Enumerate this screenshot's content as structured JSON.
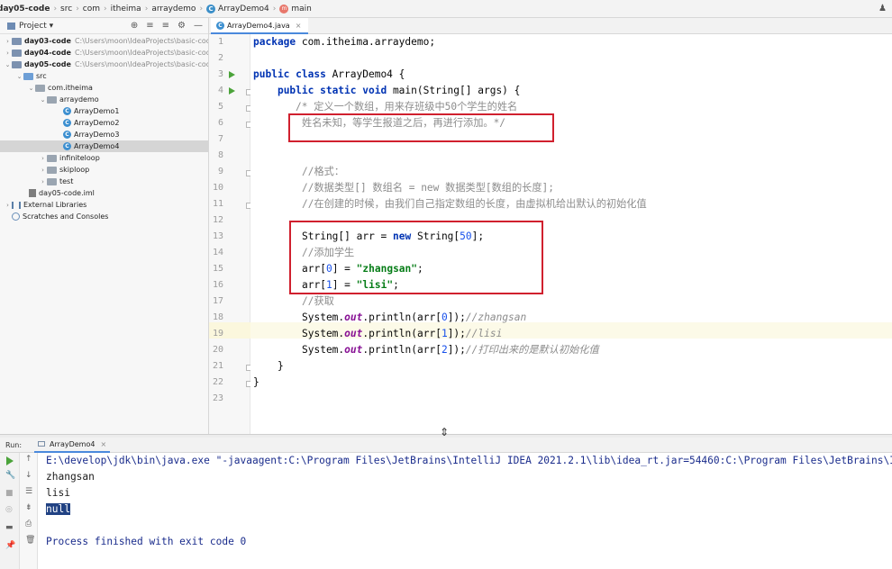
{
  "breadcrumb": [
    "day05-code",
    "src",
    "com",
    "itheima",
    "arraydemo",
    "ArrayDemo4",
    "main"
  ],
  "project_panel": {
    "title": "Project",
    "tree": [
      {
        "label": "day03-code",
        "path": "C:\\Users\\moon\\IdeaProjects\\basic-code"
      },
      {
        "label": "day04-code",
        "path": "C:\\Users\\moon\\IdeaProjects\\basic-code"
      },
      {
        "label": "day05-code",
        "path": "C:\\Users\\moon\\IdeaProjects\\basic-code"
      },
      {
        "label": "src"
      },
      {
        "label": "com.itheima"
      },
      {
        "label": "arraydemo"
      },
      {
        "label": "ArrayDemo1"
      },
      {
        "label": "ArrayDemo2"
      },
      {
        "label": "ArrayDemo3"
      },
      {
        "label": "ArrayDemo4"
      },
      {
        "label": "infiniteloop"
      },
      {
        "label": "skiploop"
      },
      {
        "label": "test"
      },
      {
        "label": "day05-code.iml"
      },
      {
        "label": "External Libraries"
      },
      {
        "label": "Scratches and Consoles"
      }
    ]
  },
  "editor": {
    "tab": "ArrayDemo4.java",
    "line_numbers": [
      "1",
      "2",
      "3",
      "4",
      "5",
      "6",
      "7",
      "8",
      "9",
      "10",
      "11",
      "12",
      "13",
      "14",
      "15",
      "16",
      "17",
      "18",
      "19",
      "20",
      "21",
      "22",
      "23"
    ],
    "lines": {
      "l1": "package com.itheima.arraydemo;",
      "l3_kw": "public class",
      "l3_rest": " ArrayDemo4 {",
      "l4_kw": "public static void",
      "l4_rest": " main(String[] args) {",
      "l5": "/* 定义一个数组，用来存班级中50个学生的姓名",
      "l6": "姓名未知，等学生报道之后，再进行添加。*/",
      "l9": "//格式：",
      "l10": "//数据类型[] 数组名 = new 数据类型[数组的长度];",
      "l11": "//在创建的时候，由我们自己指定数组的长度，由虚拟机给出默认的初始化值",
      "l13_a": "String[] arr = ",
      "l13_kw": "new",
      "l13_b": " String[",
      "l13_num": "50",
      "l13_c": "];",
      "l14": "//添加学生",
      "l15_a": "arr[",
      "l15_num": "0",
      "l15_b": "] = ",
      "l15_str": "\"zhangsan\"",
      "l15_c": ";",
      "l16_a": "arr[",
      "l16_num": "1",
      "l16_b": "] = ",
      "l16_str": "\"lisi\"",
      "l16_c": ";",
      "l17": "//获取",
      "l18_a": "System.",
      "l18_out": "out",
      "l18_b": ".println(arr[",
      "l18_num": "0",
      "l18_c": "]);",
      "l18_cm": "//zhangsan",
      "l19_a": "System.",
      "l19_out": "out",
      "l19_b": ".println(arr[",
      "l19_num": "1",
      "l19_c": "]);",
      "l19_cm": "//lisi",
      "l20_a": "System.",
      "l20_out": "out",
      "l20_b": ".println(arr[",
      "l20_num": "2",
      "l20_c": "]);",
      "l20_cm": "//打印出来的是默认初始化值",
      "l21": "}",
      "l22": "}"
    }
  },
  "run_panel": {
    "label": "Run:",
    "tab": "ArrayDemo4",
    "output": {
      "cmd": "E:\\develop\\jdk\\bin\\java.exe \"-javaagent:C:\\Program Files\\JetBrains\\IntelliJ IDEA 2021.2.1\\lib\\idea_rt.jar=54460:C:\\Program Files\\JetBrains\\Int",
      "line1": "zhangsan",
      "line2": "lisi",
      "line3": "null",
      "finish": "Process finished with exit code 0"
    }
  }
}
